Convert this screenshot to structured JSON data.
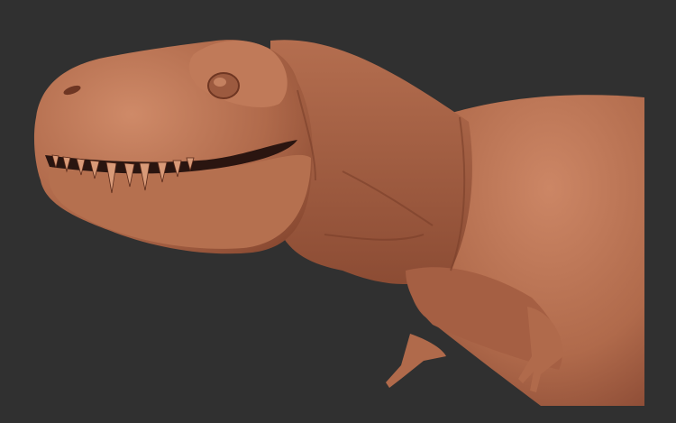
{
  "scene": {
    "subject": "t-rex-sculpt",
    "colors": {
      "background": "#303030",
      "skin": "#b26b4d",
      "skin_light": "#c98463",
      "skin_shadow": "#7a3f2a",
      "mouth": "#2a1510",
      "teeth": "#d99a78"
    }
  }
}
